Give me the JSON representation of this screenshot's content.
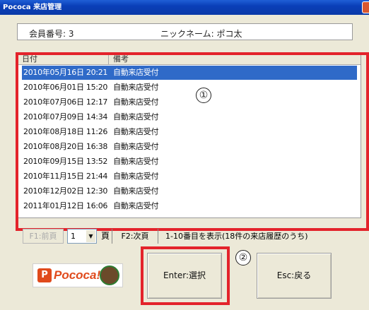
{
  "window": {
    "title": "Pococa 来店管理"
  },
  "header": {
    "member": "会員番号: 3",
    "nickname": "ニックネーム: ポコ太"
  },
  "list": {
    "columns": [
      "日付",
      "備考"
    ],
    "rows": [
      {
        "date": "2010年05月16日 20:21",
        "note": "自動来店受付"
      },
      {
        "date": "2010年06月01日 15:20",
        "note": "自動来店受付"
      },
      {
        "date": "2010年07月06日 12:17",
        "note": "自動来店受付"
      },
      {
        "date": "2010年07月09日 14:34",
        "note": "自動来店受付"
      },
      {
        "date": "2010年08月18日 11:26",
        "note": "自動来店受付"
      },
      {
        "date": "2010年08月20日 16:38",
        "note": "自動来店受付"
      },
      {
        "date": "2010年09月15日 13:52",
        "note": "自動来店受付"
      },
      {
        "date": "2010年11月15日 21:44",
        "note": "自動来店受付"
      },
      {
        "date": "2010年12月02日 12:30",
        "note": "自動来店受付"
      },
      {
        "date": "2011年01月12日 16:06",
        "note": "自動来店受付"
      }
    ]
  },
  "pager": {
    "prev": "F1:前頁",
    "page": "1",
    "unit": "頁",
    "next": "F2:次頁",
    "range": "1-10番目を表示(18件の来店履歴のうち)"
  },
  "buttons": {
    "enter": "Enter:選択",
    "esc": "Esc:戻る"
  },
  "annotations": {
    "one": "①",
    "two": "②"
  },
  "logo": {
    "text": "Pococa!"
  },
  "colors": {
    "annotation": "#e3232b",
    "selection": "#2f6ac8",
    "titlebar": "#0a3fb8"
  }
}
